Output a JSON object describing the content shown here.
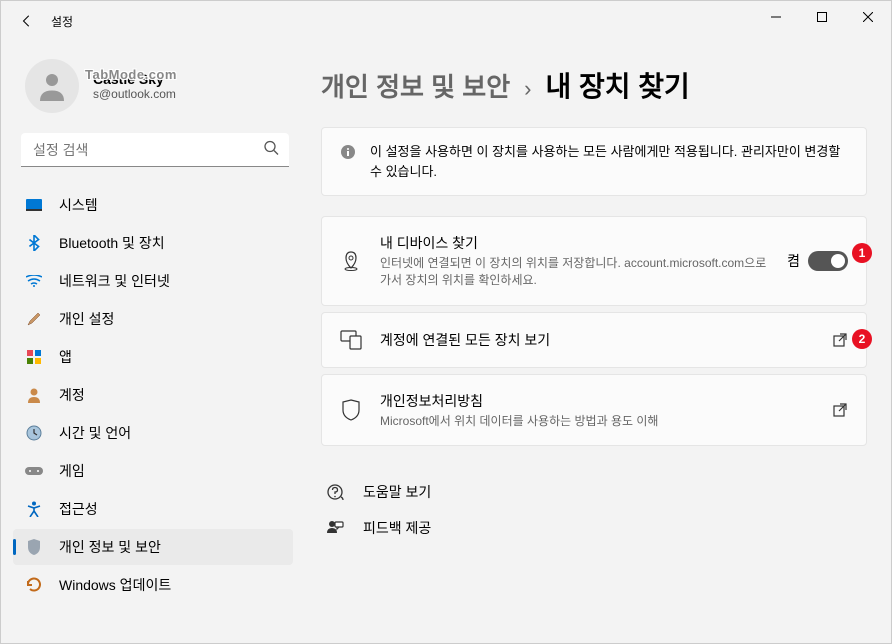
{
  "window": {
    "title": "설정"
  },
  "user": {
    "name": "Castle Sky",
    "email": "s@outlook.com",
    "watermark": "TabMode.com"
  },
  "search": {
    "placeholder": "설정 검색"
  },
  "sidebar": {
    "items": [
      {
        "label": "시스템",
        "icon": "system"
      },
      {
        "label": "Bluetooth 및 장치",
        "icon": "bluetooth"
      },
      {
        "label": "네트워크 및 인터넷",
        "icon": "network"
      },
      {
        "label": "개인 설정",
        "icon": "personalize"
      },
      {
        "label": "앱",
        "icon": "apps"
      },
      {
        "label": "계정",
        "icon": "account"
      },
      {
        "label": "시간 및 언어",
        "icon": "time"
      },
      {
        "label": "게임",
        "icon": "gaming"
      },
      {
        "label": "접근성",
        "icon": "accessibility"
      },
      {
        "label": "개인 정보 및 보안",
        "icon": "privacy"
      },
      {
        "label": "Windows 업데이트",
        "icon": "update"
      }
    ]
  },
  "breadcrumb": {
    "parent": "개인 정보 및 보안",
    "current": "내 장치 찾기"
  },
  "banner": {
    "text": "이 설정을 사용하면 이 장치를 사용하는 모든 사람에게만 적용됩니다. 관리자만이 변경할 수 있습니다."
  },
  "cards": {
    "find_device": {
      "title": "내 디바이스 찾기",
      "desc": "인터넷에 연결되면 이 장치의 위치를 저장합니다. account.microsoft.com으로 가서 장치의 위치를 확인하세요.",
      "toggle_label": "켬",
      "badge": "1"
    },
    "all_devices": {
      "title": "계정에 연결된 모든 장치 보기",
      "badge": "2"
    },
    "privacy_policy": {
      "title": "개인정보처리방침",
      "desc": "Microsoft에서 위치 데이터를 사용하는 방법과 용도 이해"
    }
  },
  "help": {
    "get_help": "도움말 보기",
    "feedback": "피드백 제공"
  }
}
